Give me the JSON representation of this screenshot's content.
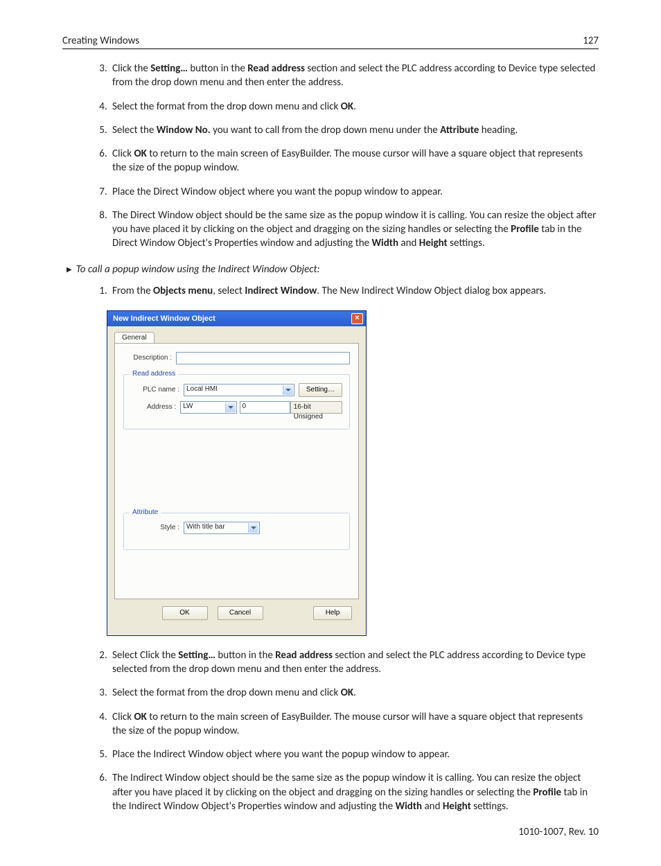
{
  "header": {
    "section_title": "Creating Windows",
    "page_no": "127"
  },
  "steps_a": [
    {
      "n": "3",
      "parts": [
        "Click the ",
        {
          "b": "Setting…"
        },
        " button in the ",
        {
          "b": "Read address"
        },
        " section and select the PLC address according to Device type selected from the drop down menu and then enter the address."
      ]
    },
    {
      "n": "4",
      "parts": [
        "Select the format from the drop down menu and click ",
        {
          "b": "OK"
        },
        "."
      ]
    },
    {
      "n": "5",
      "parts": [
        "Select the ",
        {
          "b": "Window No."
        },
        " you want to call from the drop down menu under the ",
        {
          "b": "Attribute"
        },
        " heading."
      ]
    },
    {
      "n": "6",
      "parts": [
        "Click ",
        {
          "b": "OK"
        },
        " to return to the main screen of EasyBuilder. The mouse cursor will have a square object that represents the size of the popup window."
      ]
    },
    {
      "n": "7",
      "parts": [
        "Place the Direct Window object where you want the popup window to appear."
      ]
    },
    {
      "n": "8",
      "parts": [
        "The Direct Window object should be the same size as the popup window it is calling. You can resize the object after you have placed it by clicking on the object and dragging on the sizing handles or selecting the ",
        {
          "b": "Profile"
        },
        " tab in the Direct Window Object's Properties window and adjusting the ",
        {
          "b": "Width"
        },
        " and ",
        {
          "b": "Height"
        },
        " settings."
      ]
    }
  ],
  "procedure_heading": "To call a popup window using the Indirect Window Object:",
  "steps_b_intro": {
    "n": "1",
    "parts": [
      "From the ",
      {
        "b": "Objects menu"
      },
      ", select ",
      {
        "b": "Indirect Window"
      },
      ". The New Indirect Window Object dialog box appears."
    ]
  },
  "dialog": {
    "title": "New  Indirect Window Object",
    "close_glyph": "×",
    "tab": "General",
    "description_label": "Description :",
    "description_value": "",
    "read_group": "Read address",
    "plc_label": "PLC name :",
    "plc_value": "Local HMI",
    "setting_btn": "Setting…",
    "addr_label": "Address :",
    "addr_type": "LW",
    "addr_value": "0",
    "format": "16-bit Unsigned",
    "attr_group": "Attribute",
    "style_label": "Style :",
    "style_value": "With title bar",
    "ok": "OK",
    "cancel": "Cancel",
    "help": "Help"
  },
  "steps_b_rest": [
    {
      "n": "2",
      "parts": [
        "Select Click the ",
        {
          "b": "Setting…"
        },
        " button in the ",
        {
          "b": "Read address"
        },
        " section and select the PLC address according to Device type selected from the drop down menu and then enter the address."
      ]
    },
    {
      "n": "3",
      "parts": [
        "Select the format from the drop down menu and click ",
        {
          "b": "OK"
        },
        "."
      ]
    },
    {
      "n": "4",
      "parts": [
        "Click ",
        {
          "b": "OK"
        },
        " to return to the main screen of EasyBuilder. The mouse cursor will have a square object that represents the size of the popup window."
      ]
    },
    {
      "n": "5",
      "parts": [
        "Place the Indirect Window object where you want the popup window to appear."
      ]
    },
    {
      "n": "6",
      "parts": [
        "The Indirect Window object should be the same size as the popup window it is calling. You can resize the object after you have placed it by clicking on the object and dragging on the sizing handles or selecting the ",
        {
          "b": "Profile"
        },
        " tab in the Indirect Window Object's Properties window and adjusting the ",
        {
          "b": "Width"
        },
        " and ",
        {
          "b": "Height"
        },
        " settings."
      ]
    }
  ],
  "footer": "1010-1007, Rev. 10"
}
